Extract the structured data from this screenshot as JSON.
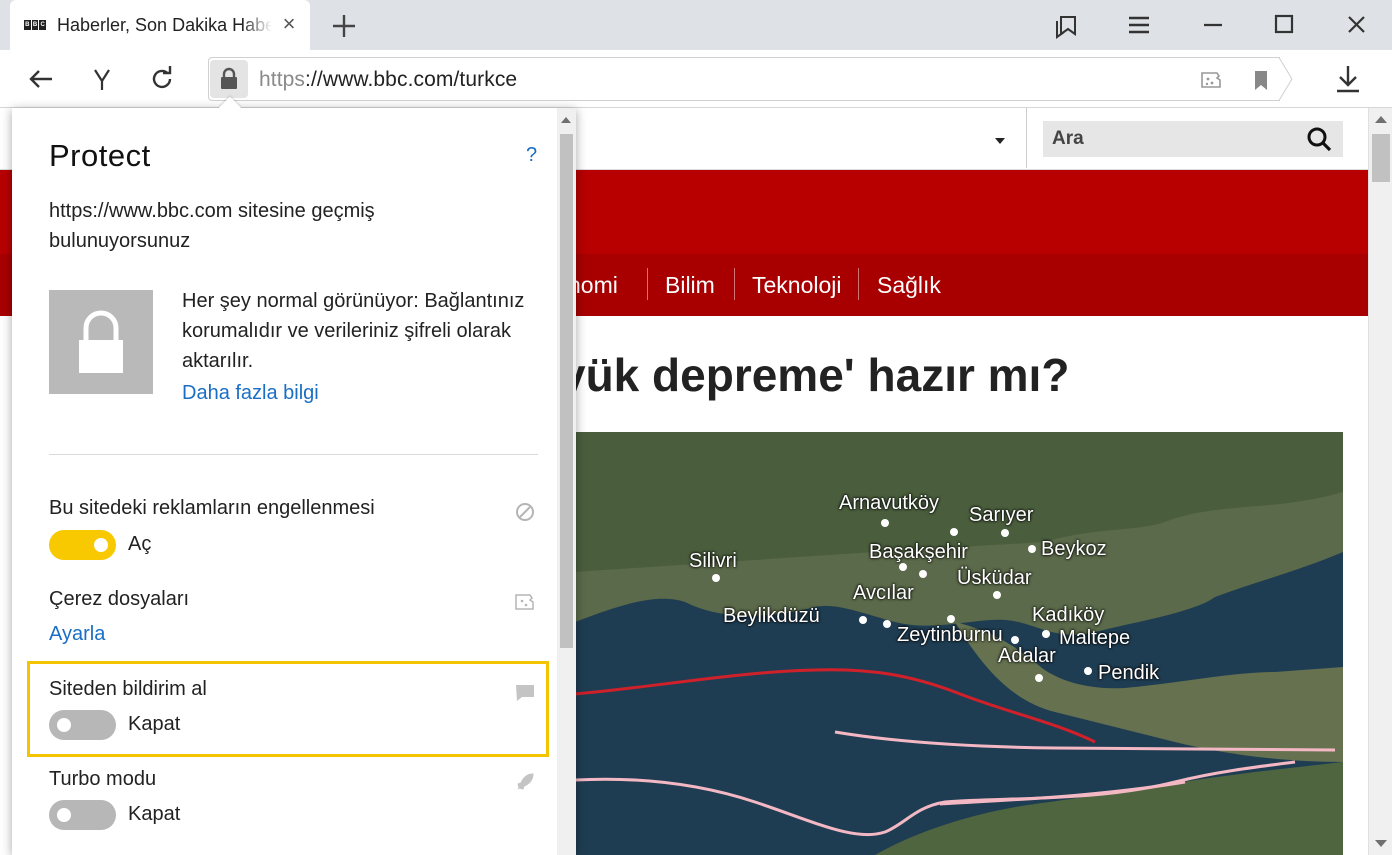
{
  "browser": {
    "tab": {
      "favicon": [
        "B",
        "B",
        "C"
      ],
      "title": "Haberler, Son Dakika Haberleri"
    },
    "url": {
      "scheme": "https",
      "rest": "://www.bbc.com/turkce"
    }
  },
  "page": {
    "search": {
      "label": "Ara"
    },
    "nav": [
      "nomi",
      "Bilim",
      "Teknoloji",
      "Sağlık"
    ],
    "headline": "yük depreme' hazır mı?",
    "map_labels": [
      "Arnavutköy",
      "Sarıyer",
      "Silivri",
      "Başakşehir",
      "Beykoz",
      "Üsküdar",
      "Avcılar",
      "Beylikdüzü",
      "Kadıköy",
      "Zeytinburnu",
      "Maltepe",
      "Adalar",
      "Pendik"
    ]
  },
  "protect": {
    "title": "Protect",
    "help": "?",
    "site_status": "https://www.bbc.com sitesine geçmiş bulunuyorsunuz",
    "status_text": "Her şey normal görünüyor: Bağlantınız korumalıdır ve verileriniz şifreli olarak aktarılır.",
    "more_link": "Daha fazla bilgi",
    "ads": {
      "title": "Bu sitedeki reklamların engellenmesi",
      "state": "Aç",
      "on": true
    },
    "cookies": {
      "title": "Çerez dosyaları",
      "link": "Ayarla"
    },
    "notifications": {
      "title": "Siteden bildirim al",
      "state": "Kapat",
      "on": false
    },
    "turbo": {
      "title": "Turbo modu",
      "state": "Kapat",
      "on": false
    }
  },
  "colors": {
    "accent_yellow": "#f8c800",
    "link_blue": "#1a6fc4",
    "bbc_red": "#b80000"
  }
}
